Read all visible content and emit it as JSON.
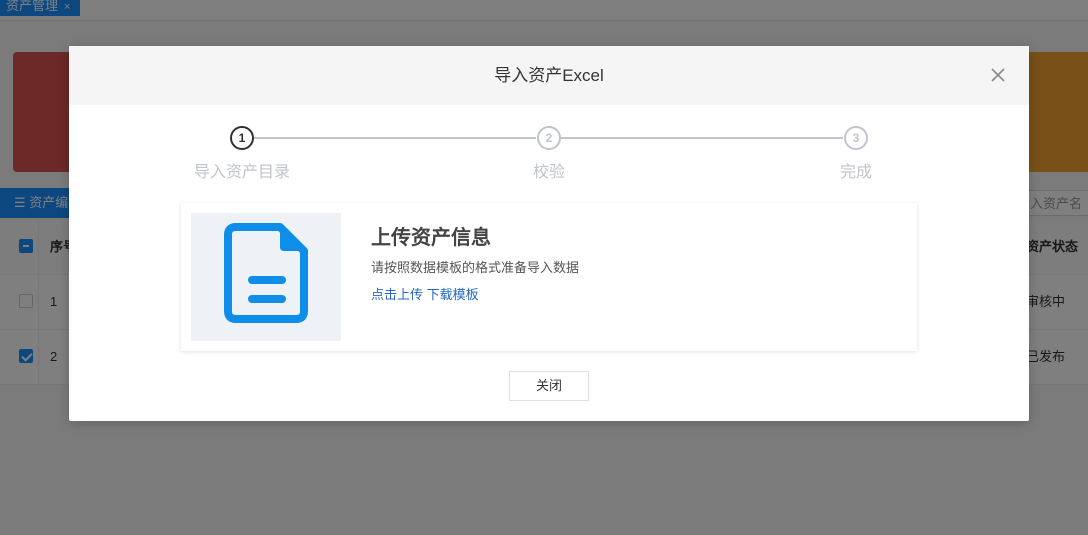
{
  "background": {
    "tab": {
      "label": "资产管理",
      "close": "×"
    },
    "toolbar": {
      "button_label": "资产编"
    },
    "search": {
      "placeholder": "输入资产名"
    },
    "table": {
      "header": {
        "seq": "序号",
        "status": "资产状态"
      },
      "rows": [
        {
          "seq": "1",
          "status": "审核中",
          "checked": false
        },
        {
          "seq": "2",
          "status": "已发布",
          "checked": true
        }
      ]
    },
    "colors": {
      "primary": "#1890ff",
      "card_red": "#d9534f",
      "card_orange": "#f0a030"
    }
  },
  "modal": {
    "title": "导入资产Excel",
    "steps": [
      {
        "number": "1",
        "label": "导入资产目录",
        "active": true
      },
      {
        "number": "2",
        "label": "校验",
        "active": false
      },
      {
        "number": "3",
        "label": "完成",
        "active": false
      }
    ],
    "upload": {
      "icon": "document-icon",
      "title": "上传资产信息",
      "description": "请按照数据模板的格式准备导入数据",
      "upload_link": "点击上传",
      "download_link": "下载模板"
    },
    "close_button": "关闭",
    "colors": {
      "link": "#2468c2",
      "icon": "#0e8ee9",
      "icon_bg": "#eef2f6"
    }
  }
}
